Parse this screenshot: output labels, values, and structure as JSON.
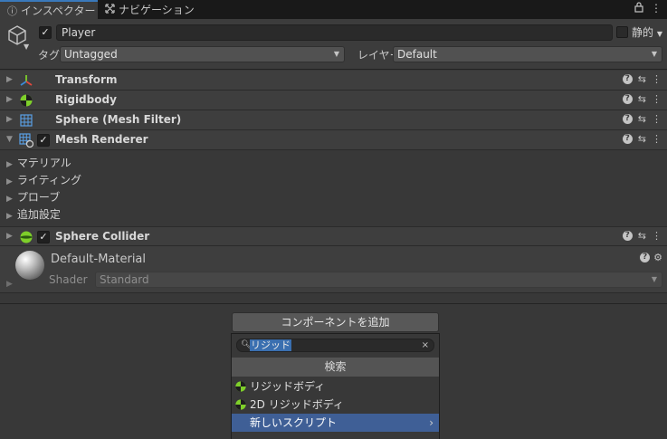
{
  "tabs": {
    "inspector": "インスペクター",
    "navigation": "ナビゲーション"
  },
  "gameobject": {
    "active": true,
    "name": "Player",
    "static_label": "静的",
    "tag_label": "タグ",
    "tag_value": "Untagged",
    "layer_label": "レイヤー",
    "layer_value": "Default"
  },
  "components": [
    {
      "name": "Transform",
      "icon": "transform-icon",
      "has_checkbox": false,
      "expanded": false
    },
    {
      "name": "Rigidbody",
      "icon": "rigidbody-icon",
      "has_checkbox": false,
      "expanded": false
    },
    {
      "name": "Sphere (Mesh Filter)",
      "icon": "mesh-filter-icon",
      "has_checkbox": false,
      "expanded": false
    },
    {
      "name": "Mesh Renderer",
      "icon": "mesh-renderer-icon",
      "has_checkbox": true,
      "enabled": true,
      "expanded": true
    },
    {
      "name": "Sphere Collider",
      "icon": "sphere-collider-icon",
      "has_checkbox": true,
      "enabled": true,
      "expanded": false
    }
  ],
  "mesh_renderer_sections": [
    "マテリアル",
    "ライティング",
    "プローブ",
    "追加設定"
  ],
  "material": {
    "name": "Default-Material",
    "shader_label": "Shader",
    "shader_value": "Standard"
  },
  "add_component": {
    "button_label": "コンポーネントを追加",
    "search_value": "リジッド",
    "results_header": "検索",
    "results": [
      {
        "label": "リジッドボディ",
        "icon": "rigidbody-icon"
      },
      {
        "label": "2D リジッドボディ",
        "icon": "rigidbody-2d-icon"
      },
      {
        "label": "新しいスクリプト",
        "icon": "",
        "selected": true,
        "has_submenu": true
      }
    ]
  },
  "colors": {
    "accent": "#3a79bb",
    "selection": "#3f5f96",
    "rigidbody_green": "#7ecf2a"
  }
}
